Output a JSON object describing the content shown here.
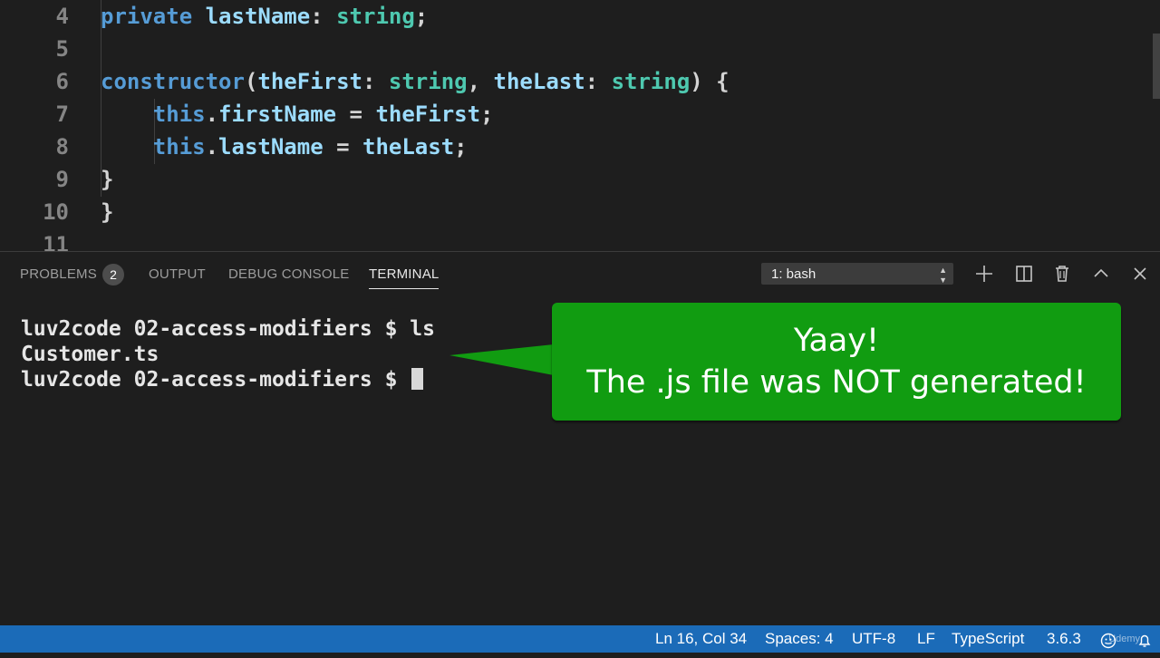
{
  "editor": {
    "lines": [
      {
        "num": "4",
        "tokens": [
          [
            "kw",
            "    private "
          ],
          [
            "prop",
            "lastName"
          ],
          [
            "punc",
            ": "
          ],
          [
            "typ",
            "string"
          ],
          [
            "punc",
            ";"
          ]
        ]
      },
      {
        "num": "5",
        "tokens": []
      },
      {
        "num": "6",
        "tokens": [
          [
            "kw",
            "    constructor"
          ],
          [
            "punc",
            "("
          ],
          [
            "prop",
            "theFirst"
          ],
          [
            "punc",
            ": "
          ],
          [
            "typ",
            "string"
          ],
          [
            "punc",
            ", "
          ],
          [
            "prop",
            "theLast"
          ],
          [
            "punc",
            ": "
          ],
          [
            "typ",
            "string"
          ],
          [
            "punc",
            ") {"
          ]
        ]
      },
      {
        "num": "7",
        "tokens": [
          [
            "kw",
            "        this"
          ],
          [
            "punc",
            "."
          ],
          [
            "prop",
            "firstName"
          ],
          [
            "punc",
            " = "
          ],
          [
            "prop",
            "theFirst"
          ],
          [
            "punc",
            ";"
          ]
        ]
      },
      {
        "num": "8",
        "tokens": [
          [
            "kw",
            "        this"
          ],
          [
            "punc",
            "."
          ],
          [
            "prop",
            "lastName"
          ],
          [
            "punc",
            " = "
          ],
          [
            "prop",
            "theLast"
          ],
          [
            "punc",
            ";"
          ]
        ]
      },
      {
        "num": "9",
        "tokens": [
          [
            "punc",
            "    }"
          ]
        ]
      },
      {
        "num": "10",
        "tokens": [
          [
            "punc",
            "}"
          ]
        ]
      },
      {
        "num": "11",
        "tokens": []
      }
    ]
  },
  "panel": {
    "tabs": {
      "problems": "PROBLEMS",
      "problems_count": "2",
      "output": "OUTPUT",
      "debug_console": "DEBUG CONSOLE",
      "terminal": "TERMINAL"
    },
    "terminal_select": "1: bash",
    "icons": [
      "plus-icon",
      "split-icon",
      "trash-icon",
      "chevron-up-icon",
      "close-icon"
    ]
  },
  "terminal": {
    "lines": [
      "luv2code 02-access-modifiers $ ls",
      "Customer.ts",
      "luv2code 02-access-modifiers $ "
    ]
  },
  "callout": {
    "line1": "Yaay!",
    "line2": "The .js file was NOT generated!",
    "color": "#119c11"
  },
  "statusbar": {
    "position": "Ln 16, Col 34",
    "spaces": "Spaces: 4",
    "encoding": "UTF-8",
    "eol": "LF",
    "language": "TypeScript",
    "version": "3.6.3",
    "watermark": "Udemy",
    "color": "#1b6bb8"
  }
}
